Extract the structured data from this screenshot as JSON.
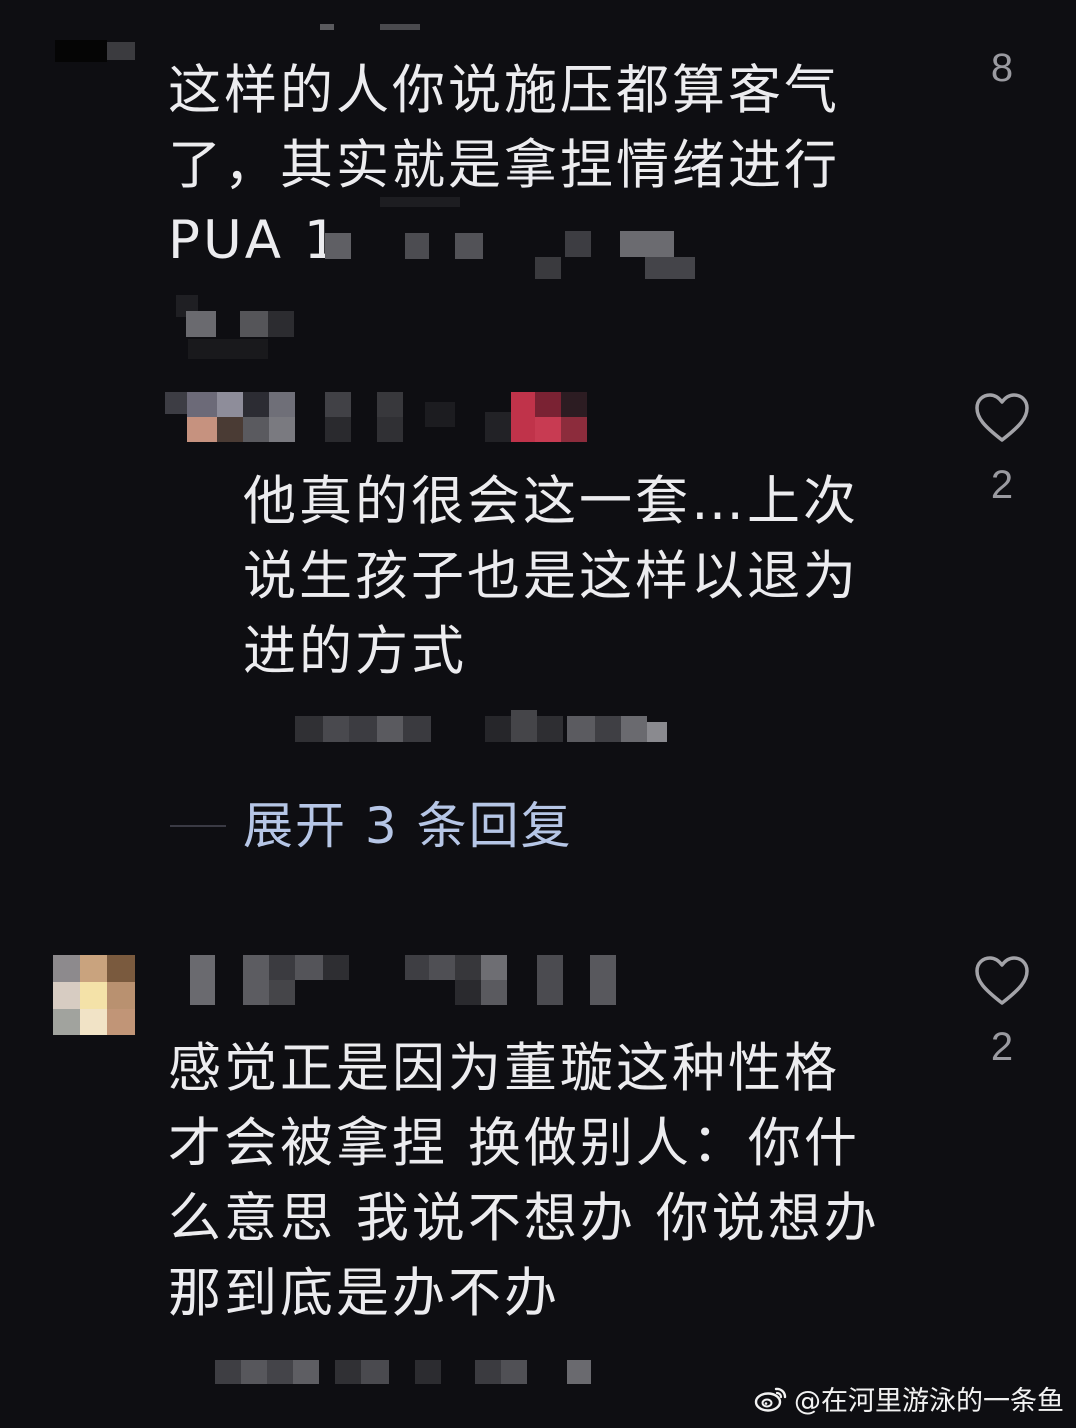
{
  "comments": [
    {
      "text": "这样的人你说施压都算客气\n了，其实就是拿捏情绪进行\nPUA 1",
      "likes": "8",
      "icon": "heart-outline-icon"
    },
    {
      "text": "他真的很会这一套…上次\n说生孩子也是这样以退为\n进的方式",
      "likes": "2",
      "icon": "heart-outline-icon",
      "expand_label": "展开 3 条回复"
    },
    {
      "text": "感觉正是因为董璇这种性格\n才会被拿捏 换做别人：你什\n么意思 我说不想办 你说想办\n那到底是办不办",
      "likes": "2",
      "icon": "heart-outline-icon"
    }
  ],
  "watermark": {
    "text": "@在河里游泳的一条鱼",
    "icon": "weibo-logo-icon"
  },
  "colors": {
    "background": "#0e0e12",
    "text": "#ececef",
    "muted": "#9a9aa0",
    "link": "#b6c6e6"
  }
}
